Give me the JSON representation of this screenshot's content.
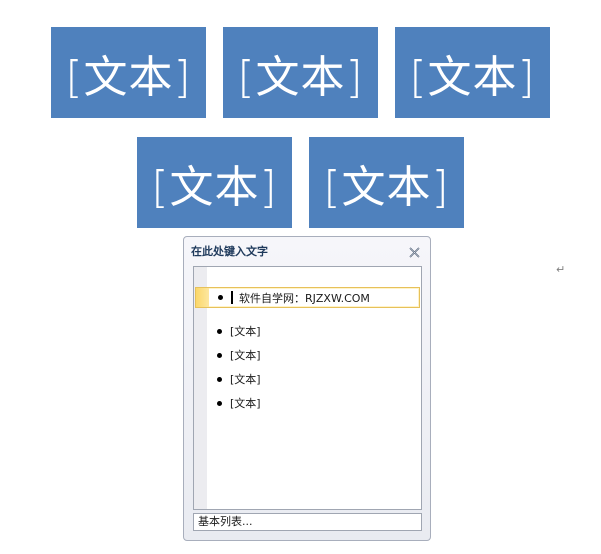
{
  "smartart": {
    "shapes": [
      {
        "label": "[文本]"
      },
      {
        "label": "[文本]"
      },
      {
        "label": "[文本]"
      },
      {
        "label": "[文本]"
      },
      {
        "label": "[文本]"
      }
    ],
    "fill_color": "#4f81bd",
    "text_color": "#ffffff"
  },
  "document": {
    "paragraph_mark": "↵"
  },
  "text_pane": {
    "title": "在此处键入文字",
    "close_icon": "close-x-icon",
    "items": [
      {
        "text": "软件自学网：RJZXW.COM",
        "selected": true
      },
      {
        "text": "[文本]",
        "selected": false
      },
      {
        "text": "[文本]",
        "selected": false
      },
      {
        "text": "[文本]",
        "selected": false
      },
      {
        "text": "[文本]",
        "selected": false
      }
    ],
    "footer": "基本列表..."
  }
}
